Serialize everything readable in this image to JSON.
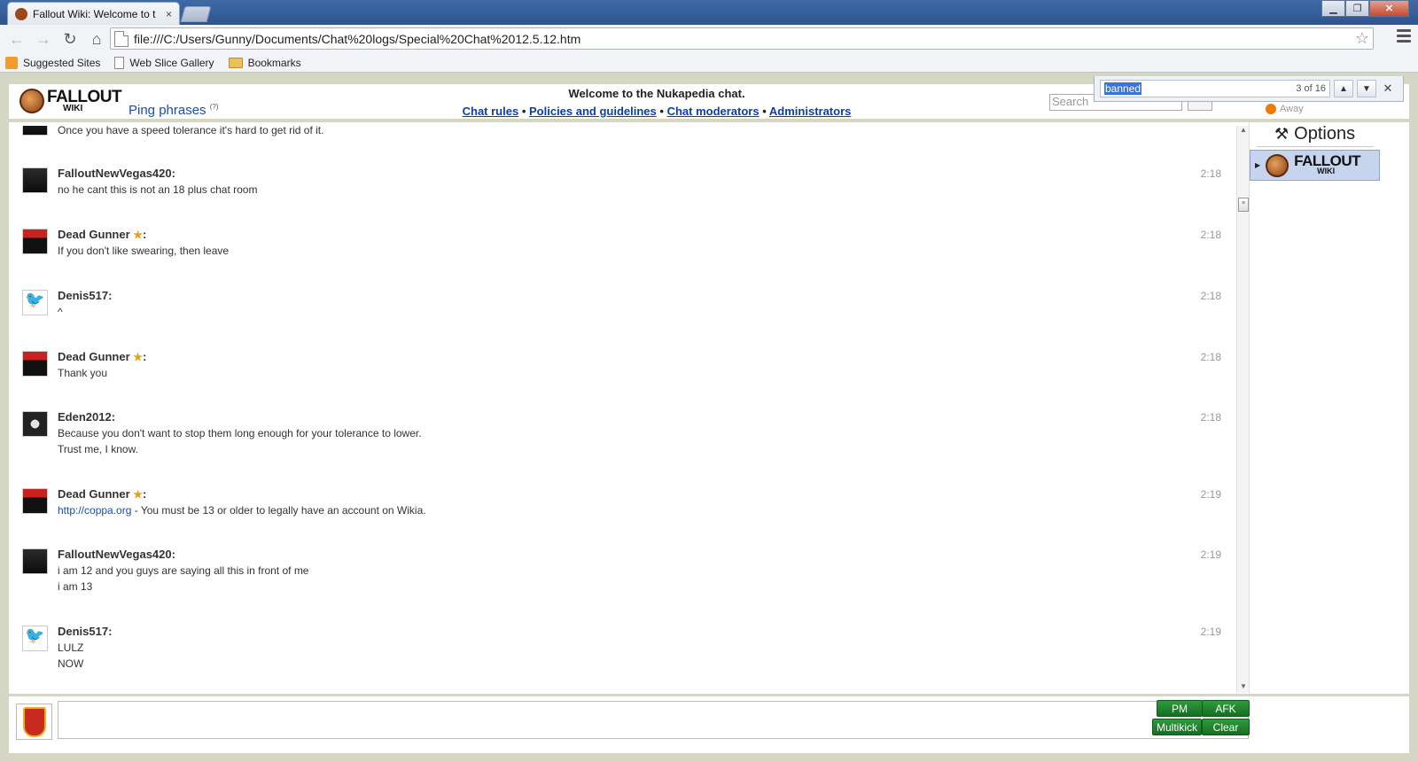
{
  "browser": {
    "tab_title": "Fallout Wiki: Welcome to t",
    "tab_close": "×",
    "url": "file:///C:/Users/Gunny/Documents/Chat%20logs/Special%20Chat%2012.5.12.htm",
    "bookmarks": [
      "Suggested Sites",
      "Web Slice Gallery",
      "Bookmarks"
    ]
  },
  "find": {
    "query": "banned",
    "count": "3 of 16"
  },
  "header": {
    "logo_big": "FALLOUT",
    "logo_small": "WIKI",
    "ping_label": "Ping phrases",
    "ping_help": "(?)",
    "welcome": "Welcome to the Nukapedia chat.",
    "links": [
      "Chat rules",
      "Policies and guidelines",
      "Chat moderators",
      "Administrators"
    ],
    "search_placeholder": "Search",
    "status": "Away"
  },
  "messages": [
    {
      "user": "",
      "time": "",
      "lines": [
        "Once you have a speed tolerance it's hard to get rid of it."
      ],
      "mod": false,
      "avatar": "dark"
    },
    {
      "user": "FalloutNewVegas420:",
      "time": "2:18",
      "lines": [
        "no he cant this is not an 18 plus chat room"
      ],
      "mod": false,
      "avatar": "dark"
    },
    {
      "user": "Dead Gunner",
      "time": "2:18",
      "lines": [
        "If you don't like swearing, then leave"
      ],
      "mod": true,
      "avatar": "santa"
    },
    {
      "user": "Denis517:",
      "time": "2:18",
      "lines": [
        "^"
      ],
      "mod": false,
      "avatar": "bird"
    },
    {
      "user": "Dead Gunner",
      "time": "2:18",
      "lines": [
        "Thank you"
      ],
      "mod": true,
      "avatar": "santa"
    },
    {
      "user": "Eden2012:",
      "time": "2:18",
      "lines": [
        "Because you don't want to stop them long enough for your tolerance to lower.",
        "Trust me, I know."
      ],
      "mod": false,
      "avatar": "skull"
    },
    {
      "user": "Dead Gunner",
      "time": "2:19",
      "lines": [
        "http://coppa.org - You must be 13 or older to legally have an account on Wikia."
      ],
      "mod": true,
      "avatar": "santa",
      "link": "http://coppa.org"
    },
    {
      "user": "FalloutNewVegas420:",
      "time": "2:19",
      "lines": [
        "i am 12 and you guys are saying all this in front of me",
        "i am 13"
      ],
      "mod": false,
      "avatar": "dark"
    },
    {
      "user": "Denis517:",
      "time": "2:19",
      "lines": [
        "LULZ",
        "NOW"
      ],
      "mod": false,
      "avatar": "bird"
    }
  ],
  "mod_suffix": ":",
  "rail": {
    "options_label": "Options",
    "room_big": "FALLOUT",
    "room_small": "WIKI"
  },
  "buttons": {
    "pm": "PM",
    "afk": "AFK",
    "multikick": "Multikick",
    "clear": "Clear"
  }
}
